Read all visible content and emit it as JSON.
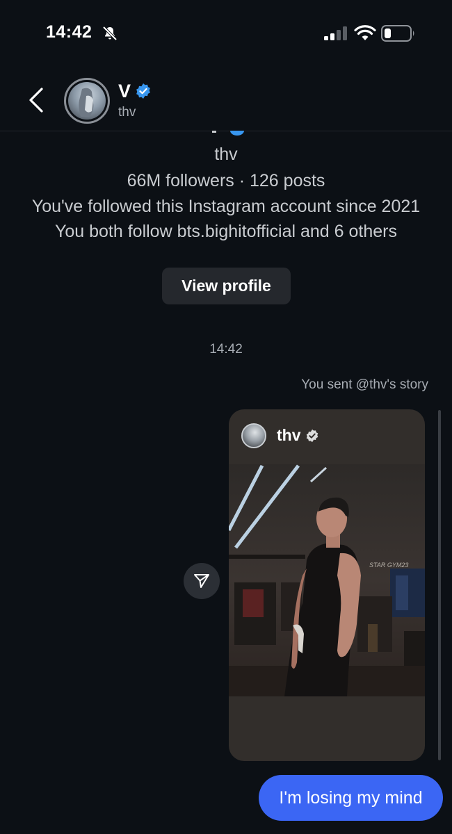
{
  "status_bar": {
    "time": "14:42",
    "icons": [
      "bell-off-icon",
      "signal-icon",
      "wifi-icon",
      "battery-icon"
    ]
  },
  "header": {
    "display_name": "V",
    "username": "thv",
    "verified": true,
    "icons": [
      "back-chevron-icon",
      "verified-badge-icon"
    ]
  },
  "profile_info": {
    "username": "thv",
    "stats": "66M followers · 126 posts",
    "follow_since": "You've followed this Instagram account since 2021",
    "mutuals": "You both follow bts.bighitofficial and 6 others",
    "view_profile_label": "View profile"
  },
  "conversation": {
    "timestamp": "14:42",
    "shared_story_label": "You sent @thv's story",
    "story_card": {
      "username": "thv",
      "verified": true
    },
    "message_text": "I'm losing my mind"
  },
  "colors": {
    "background": "#0c1015",
    "verified_blue": "#3897f0",
    "bubble_blue": "#3b66f4",
    "button_bg": "#25282d",
    "secondary_text": "#a8adb4"
  }
}
